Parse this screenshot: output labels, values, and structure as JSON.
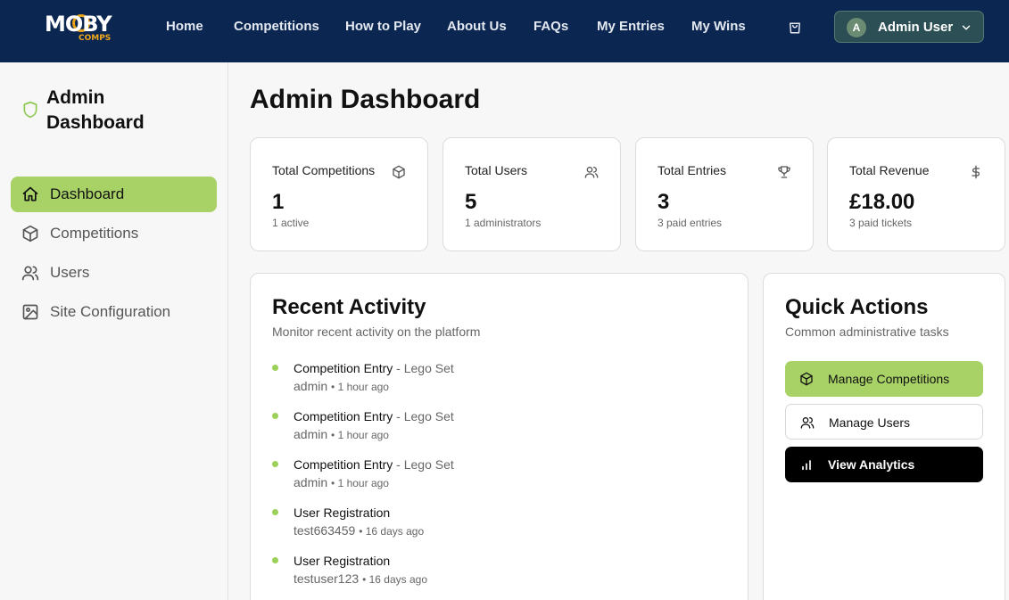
{
  "brand": {
    "logo_main": "MOBY",
    "logo_sub": "COMPS"
  },
  "nav": {
    "links": [
      "Home",
      "Competitions",
      "How to Play",
      "About Us",
      "FAQs",
      "My Entries",
      "My Wins"
    ],
    "cart_icon": "shopping-bag-icon",
    "user": {
      "initial": "A",
      "name": "Admin User",
      "chevron_icon": "chevron-down-icon"
    }
  },
  "sidebar": {
    "title": "Admin Dashboard",
    "shield_icon": "shield-icon",
    "items": [
      {
        "label": "Dashboard",
        "icon": "home-icon",
        "active": true
      },
      {
        "label": "Competitions",
        "icon": "box-icon",
        "active": false
      },
      {
        "label": "Users",
        "icon": "users-icon",
        "active": false
      },
      {
        "label": "Site Configuration",
        "icon": "image-icon",
        "active": false
      }
    ]
  },
  "main": {
    "title": "Admin Dashboard",
    "stats": [
      {
        "label": "Total Competitions",
        "value": "1",
        "sub": "1 active",
        "icon": "box-icon"
      },
      {
        "label": "Total Users",
        "value": "5",
        "sub": "1 administrators",
        "icon": "users-icon"
      },
      {
        "label": "Total Entries",
        "value": "3",
        "sub": "3 paid entries",
        "icon": "trophy-icon"
      },
      {
        "label": "Total Revenue",
        "value": "£18.00",
        "sub": "3 paid tickets",
        "icon": "dollar-icon"
      }
    ],
    "recent_activity": {
      "title": "Recent Activity",
      "subtitle": "Monitor recent activity on the platform",
      "items": [
        {
          "type": "Competition Entry",
          "detail": " - Lego Set",
          "user": "admin",
          "time": "1 hour ago"
        },
        {
          "type": "Competition Entry",
          "detail": " - Lego Set",
          "user": "admin",
          "time": "1 hour ago"
        },
        {
          "type": "Competition Entry",
          "detail": " - Lego Set",
          "user": "admin",
          "time": "1 hour ago"
        },
        {
          "type": "User Registration",
          "detail": "",
          "user": "test663459",
          "time": "16 days ago"
        },
        {
          "type": "User Registration",
          "detail": "",
          "user": "testuser123",
          "time": "16 days ago"
        }
      ]
    },
    "quick_actions": {
      "title": "Quick Actions",
      "subtitle": "Common administrative tasks",
      "buttons": [
        {
          "label": "Manage Competitions",
          "icon": "box-icon"
        },
        {
          "label": "Manage Users",
          "icon": "users-icon"
        },
        {
          "label": "View Analytics",
          "icon": "bar-chart-icon"
        }
      ]
    }
  },
  "colors": {
    "nav_bg": "#0b2650",
    "accent_green": "#a8d266",
    "dot_green": "#9bd05a"
  }
}
